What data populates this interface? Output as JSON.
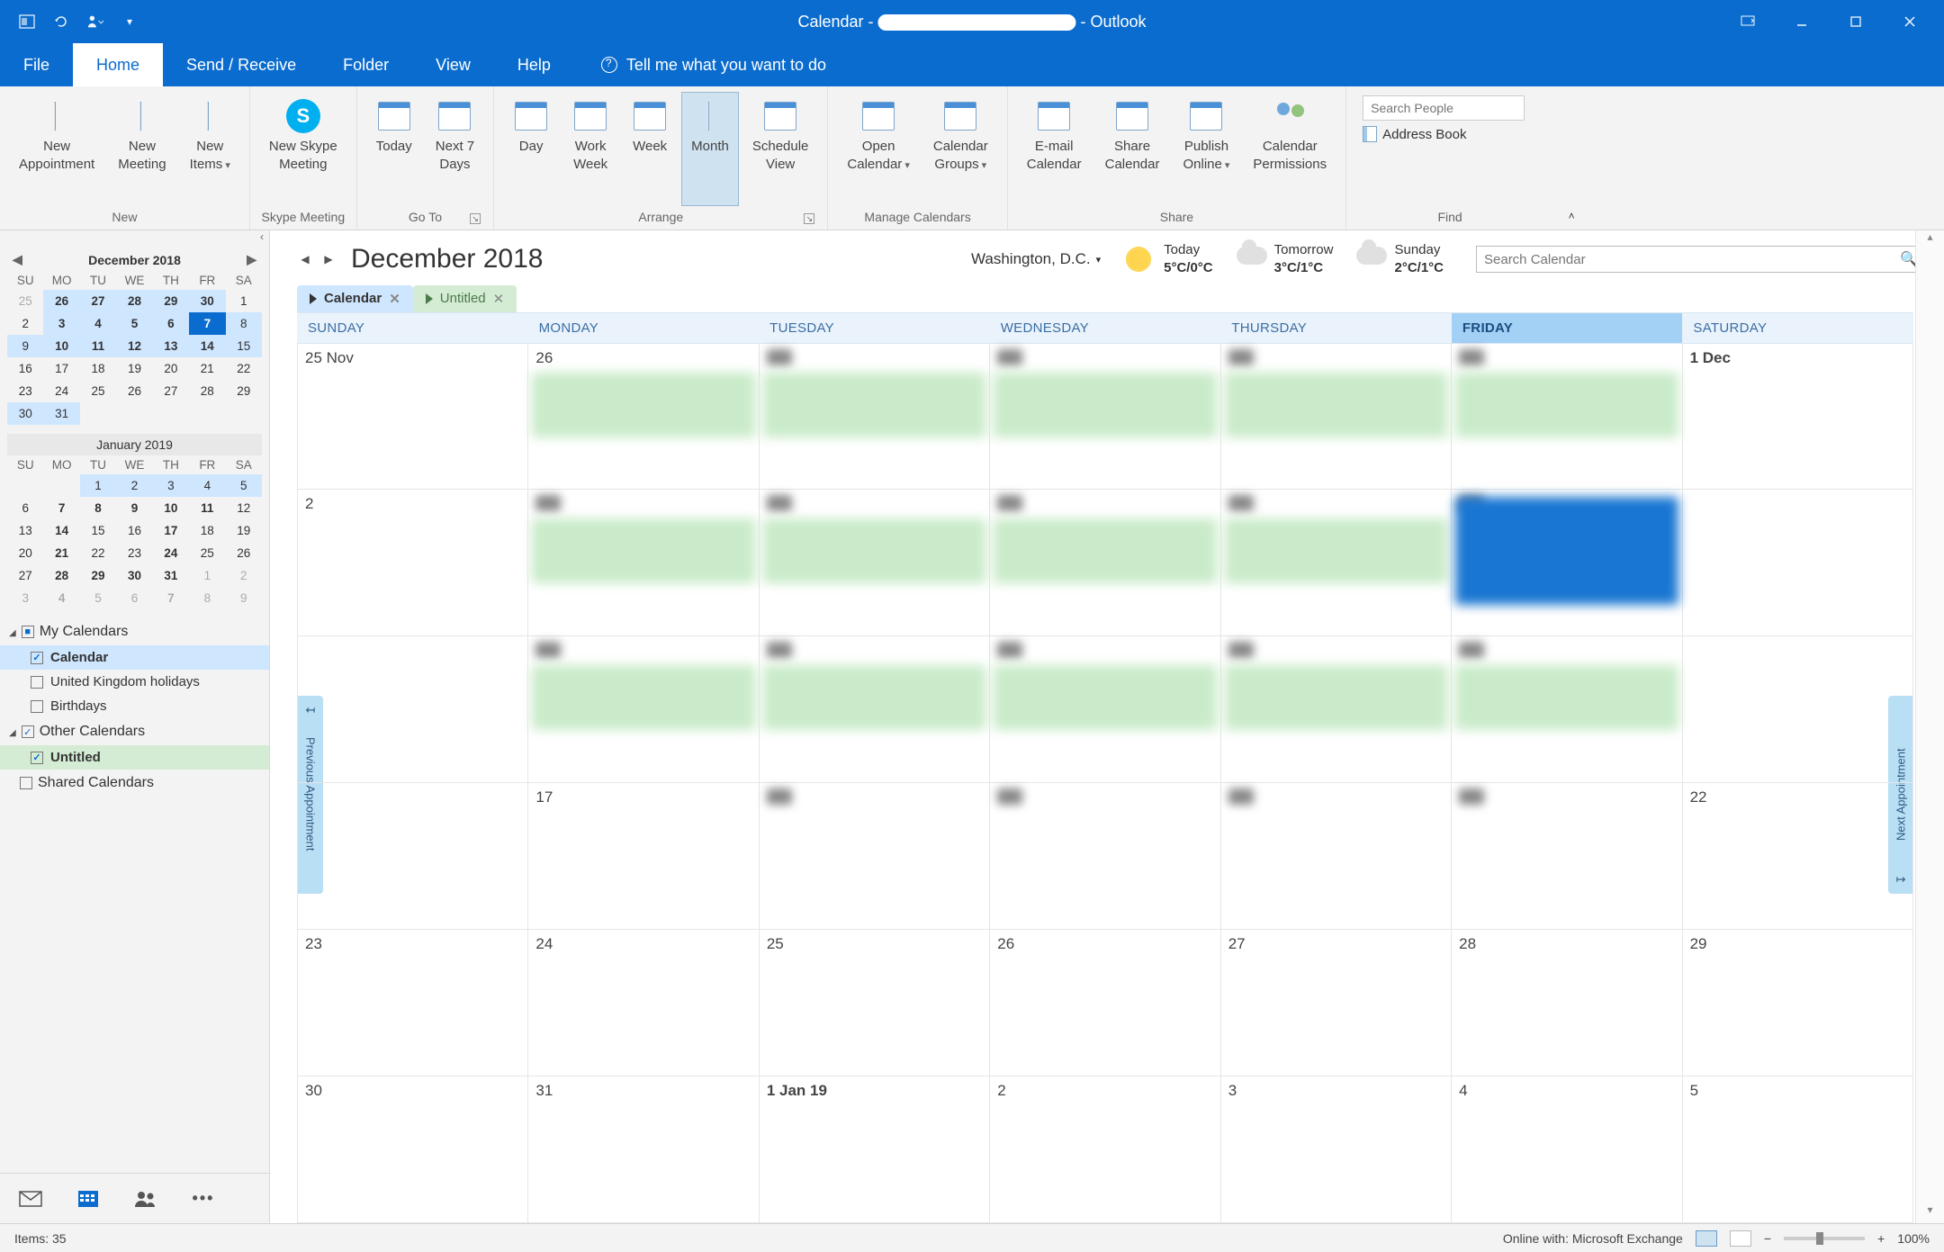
{
  "titlebar": {
    "app_prefix": "Calendar -",
    "app_suffix": "- Outlook"
  },
  "menu": {
    "file": "File",
    "home": "Home",
    "sendrecv": "Send / Receive",
    "folder": "Folder",
    "view": "View",
    "help": "Help",
    "tellme": "Tell me what you want to do"
  },
  "ribbon": {
    "groups": {
      "new": {
        "label": "New",
        "new_appointment": "New\nAppointment",
        "new_meeting": "New\nMeeting",
        "new_items": "New\nItems"
      },
      "skype": {
        "label": "Skype Meeting",
        "btn": "New Skype\nMeeting"
      },
      "goto": {
        "label": "Go To",
        "today": "Today",
        "next7": "Next 7\nDays"
      },
      "arrange": {
        "label": "Arrange",
        "day": "Day",
        "workweek": "Work\nWeek",
        "week": "Week",
        "month": "Month",
        "schedule": "Schedule\nView"
      },
      "manage": {
        "label": "Manage Calendars",
        "open": "Open\nCalendar",
        "groups": "Calendar\nGroups"
      },
      "share": {
        "label": "Share",
        "email": "E-mail\nCalendar",
        "sharec": "Share\nCalendar",
        "publish": "Publish\nOnline",
        "perms": "Calendar\nPermissions"
      },
      "find": {
        "label": "Find",
        "search_placeholder": "Search People",
        "address_book": "Address Book"
      }
    }
  },
  "minical1": {
    "title": "December 2018",
    "dow": [
      "SU",
      "MO",
      "TU",
      "WE",
      "TH",
      "FR",
      "SA"
    ],
    "rows": [
      [
        {
          "n": "25",
          "dim": true
        },
        {
          "n": "26",
          "b": true,
          "hl": true
        },
        {
          "n": "27",
          "b": true,
          "hl": true
        },
        {
          "n": "28",
          "b": true,
          "hl": true
        },
        {
          "n": "29",
          "b": true,
          "hl": true
        },
        {
          "n": "30",
          "b": true,
          "hl": true
        },
        {
          "n": "1"
        }
      ],
      [
        {
          "n": "2"
        },
        {
          "n": "3",
          "b": true,
          "hl": true
        },
        {
          "n": "4",
          "b": true,
          "hl": true
        },
        {
          "n": "5",
          "b": true,
          "hl": true
        },
        {
          "n": "6",
          "b": true,
          "hl": true
        },
        {
          "n": "7",
          "today": true
        },
        {
          "n": "8",
          "hl": true
        }
      ],
      [
        {
          "n": "9",
          "hl": true
        },
        {
          "n": "10",
          "b": true,
          "hl": true
        },
        {
          "n": "11",
          "b": true,
          "hl": true
        },
        {
          "n": "12",
          "b": true,
          "hl": true
        },
        {
          "n": "13",
          "b": true,
          "hl": true
        },
        {
          "n": "14",
          "b": true,
          "hl": true
        },
        {
          "n": "15",
          "hl": true
        }
      ],
      [
        {
          "n": "16"
        },
        {
          "n": "17"
        },
        {
          "n": "18"
        },
        {
          "n": "19"
        },
        {
          "n": "20"
        },
        {
          "n": "21"
        },
        {
          "n": "22"
        }
      ],
      [
        {
          "n": "23"
        },
        {
          "n": "24"
        },
        {
          "n": "25"
        },
        {
          "n": "26"
        },
        {
          "n": "27"
        },
        {
          "n": "28"
        },
        {
          "n": "29"
        }
      ],
      [
        {
          "n": "30",
          "hl": true
        },
        {
          "n": "31",
          "hl": true
        },
        {
          "n": ""
        },
        {
          "n": ""
        },
        {
          "n": ""
        },
        {
          "n": ""
        },
        {
          "n": ""
        }
      ]
    ]
  },
  "minical2": {
    "title": "January 2019",
    "rows": [
      [
        {
          "n": ""
        },
        {
          "n": ""
        },
        {
          "n": "1",
          "hl": true
        },
        {
          "n": "2",
          "hl": true
        },
        {
          "n": "3",
          "hl": true
        },
        {
          "n": "4",
          "hl": true
        },
        {
          "n": "5",
          "hl": true
        }
      ],
      [
        {
          "n": "6"
        },
        {
          "n": "7",
          "b": true
        },
        {
          "n": "8",
          "b": true
        },
        {
          "n": "9",
          "b": true
        },
        {
          "n": "10",
          "b": true
        },
        {
          "n": "11",
          "b": true
        },
        {
          "n": "12"
        }
      ],
      [
        {
          "n": "13"
        },
        {
          "n": "14",
          "b": true
        },
        {
          "n": "15"
        },
        {
          "n": "16"
        },
        {
          "n": "17",
          "b": true
        },
        {
          "n": "18"
        },
        {
          "n": "19"
        }
      ],
      [
        {
          "n": "20"
        },
        {
          "n": "21",
          "b": true
        },
        {
          "n": "22"
        },
        {
          "n": "23"
        },
        {
          "n": "24",
          "b": true
        },
        {
          "n": "25"
        },
        {
          "n": "26"
        }
      ],
      [
        {
          "n": "27"
        },
        {
          "n": "28",
          "b": true
        },
        {
          "n": "29",
          "b": true
        },
        {
          "n": "30",
          "b": true
        },
        {
          "n": "31",
          "b": true
        },
        {
          "n": "1",
          "dim": true
        },
        {
          "n": "2",
          "dim": true
        }
      ],
      [
        {
          "n": "3",
          "dim": true
        },
        {
          "n": "4",
          "b": true,
          "dim": true
        },
        {
          "n": "5",
          "dim": true
        },
        {
          "n": "6",
          "dim": true
        },
        {
          "n": "7",
          "b": true,
          "dim": true
        },
        {
          "n": "8",
          "dim": true
        },
        {
          "n": "9",
          "dim": true
        }
      ]
    ]
  },
  "calgroups": {
    "my": {
      "title": "My Calendars",
      "items": [
        {
          "name": "Calendar",
          "checked": true,
          "sel": true
        },
        {
          "name": "United Kingdom holidays",
          "checked": false
        },
        {
          "name": "Birthdays",
          "checked": false
        }
      ]
    },
    "other": {
      "title": "Other Calendars",
      "items": [
        {
          "name": "Untitled",
          "checked": true,
          "sel2": true
        }
      ]
    },
    "shared": {
      "title": "Shared Calendars"
    }
  },
  "content": {
    "month_title": "December 2018",
    "city": "Washington,  D.C.",
    "weather": [
      {
        "label": "Today",
        "temp": "5°C/0°C",
        "icon": "sun"
      },
      {
        "label": "Tomorrow",
        "temp": "3°C/1°C",
        "icon": "cloud"
      },
      {
        "label": "Sunday",
        "temp": "2°C/1°C",
        "icon": "cloud"
      }
    ],
    "search_placeholder": "Search Calendar",
    "tabs": [
      {
        "name": "Calendar",
        "cls": "t1"
      },
      {
        "name": "Untitled",
        "cls": "t2"
      }
    ],
    "day_headers": [
      "SUNDAY",
      "MONDAY",
      "TUESDAY",
      "WEDNESDAY",
      "THURSDAY",
      "FRIDAY",
      "SATURDAY"
    ],
    "friday_index": 5,
    "weeks": [
      [
        {
          "t": "25 Nov"
        },
        {
          "t": "26",
          "ev": true
        },
        {
          "blur": true,
          "ev": true
        },
        {
          "blur": true,
          "ev": true
        },
        {
          "blur": true,
          "ev": true
        },
        {
          "blur": true,
          "ev": true
        },
        {
          "t": "1 Dec",
          "bold": true
        }
      ],
      [
        {
          "t": "2"
        },
        {
          "blur": true,
          "ev": true
        },
        {
          "blur": true,
          "ev": true
        },
        {
          "blur": true,
          "ev": true
        },
        {
          "blur": true,
          "ev": true
        },
        {
          "blur": true,
          "evblue": true
        },
        {
          "t": ""
        }
      ],
      [
        {
          "t": ""
        },
        {
          "blur": true,
          "ev": true
        },
        {
          "blur": true,
          "ev": true
        },
        {
          "blur": true,
          "ev": true
        },
        {
          "blur": true,
          "ev": true
        },
        {
          "blur": true,
          "ev": true
        },
        {
          "t": ""
        }
      ],
      [
        {
          "t": ""
        },
        {
          "t": "17",
          "blurn": true
        },
        {
          "blur": true
        },
        {
          "blur": true
        },
        {
          "blur": true
        },
        {
          "blur": true
        },
        {
          "t": "22"
        }
      ],
      [
        {
          "t": "23"
        },
        {
          "t": "24"
        },
        {
          "t": "25"
        },
        {
          "t": "26"
        },
        {
          "t": "27"
        },
        {
          "t": "28"
        },
        {
          "t": "29"
        }
      ],
      [
        {
          "t": "30"
        },
        {
          "t": "31"
        },
        {
          "t": "1 Jan 19",
          "bold": true
        },
        {
          "t": "2"
        },
        {
          "t": "3"
        },
        {
          "t": "4"
        },
        {
          "t": "5"
        }
      ]
    ],
    "prev_label": "Previous Appointment",
    "next_label": "Next Appointment"
  },
  "statusbar": {
    "items": "Items: 35",
    "online": "Online with: Microsoft Exchange",
    "zoom": "100%"
  }
}
